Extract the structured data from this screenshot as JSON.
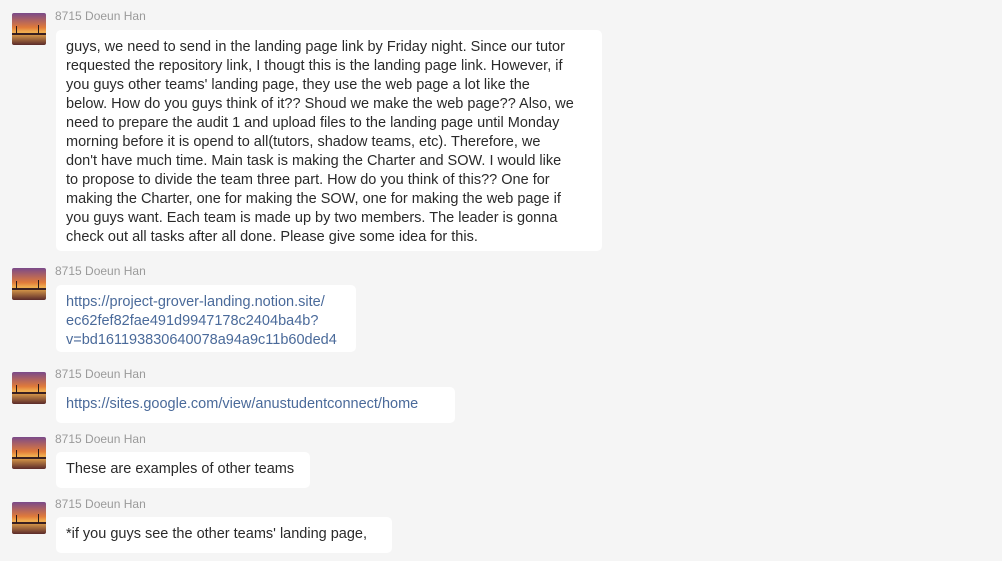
{
  "colors": {
    "background": "#f5f5f5",
    "bubble": "#ffffff",
    "link": "#4a6a9a",
    "sender": "#9a9a9a"
  },
  "messages": [
    {
      "sender": "8715 Doeun Han",
      "lines": [
        "guys, we need to send in the landing page link by Friday night. Since our tutor",
        "requested the repository link, I thougt this is the landing page link. However, if",
        "you guys other teams' landing page, they use the web page a lot like the",
        "below. How do you guys think of it?? Shoud we make the web page?? Also, we",
        "need to prepare the audit 1 and upload files to the landing page until Monday",
        "morning before it is opend to all(tutors, shadow teams, etc). Therefore, we",
        "don't have much time. Main task is making the Charter and SOW. I would like",
        "to propose to divide the team three part. How do you think of this?? One for",
        "making the Charter, one for making the SOW, one for making the web page if",
        "you guys want. Each team is made up by two members. The leader is gonna",
        "check out all tasks after all done. Please give some idea for this."
      ]
    },
    {
      "sender": "8715 Doeun Han",
      "link_lines": [
        "https://project-grover-landing.notion.site/",
        "ec62fef82fae491d9947178c2404ba4b?",
        "v=bd161193830640078a94a9c11b60ded4"
      ]
    },
    {
      "sender": "8715 Doeun Han",
      "link": "https://sites.google.com/view/anustudentconnect/home"
    },
    {
      "sender": "8715 Doeun Han",
      "text": "These are examples of other teams"
    },
    {
      "sender": "8715 Doeun Han",
      "text": "*if you guys see the other teams' landing page,"
    }
  ]
}
